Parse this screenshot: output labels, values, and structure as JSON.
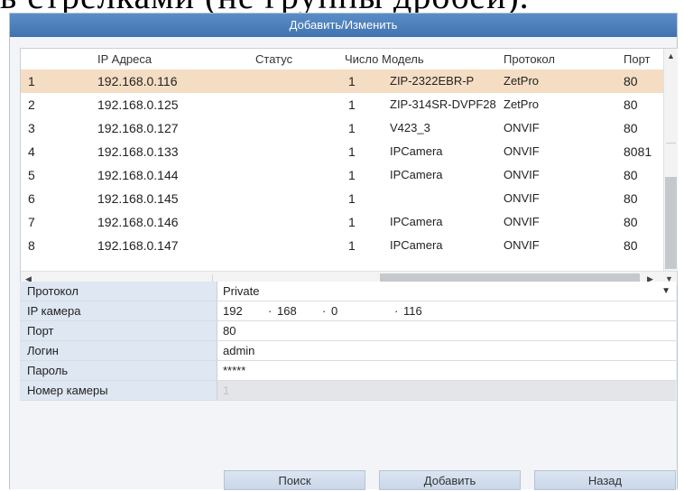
{
  "background_text": "ь стрелками (не группы дробей).",
  "dialog": {
    "title": "Добавить/Изменить"
  },
  "table": {
    "headers": {
      "ip": "IP Адреса",
      "status": "Статус",
      "count": "Число",
      "model": "Модель",
      "protocol": "Протокол",
      "port": "Порт"
    },
    "rows": [
      {
        "num": "1",
        "ip": "192.168.0.116",
        "status": "",
        "count": "1",
        "model": "ZIP-2322EBR-P",
        "protocol": "ZetPro",
        "port": "80",
        "selected": true
      },
      {
        "num": "2",
        "ip": "192.168.0.125",
        "status": "",
        "count": "1",
        "model": "ZIP-314SR-DVPF28",
        "protocol": "ZetPro",
        "port": "80"
      },
      {
        "num": "3",
        "ip": "192.168.0.127",
        "status": "",
        "count": "1",
        "model": "V423_3",
        "protocol": "ONVIF",
        "port": "80"
      },
      {
        "num": "4",
        "ip": "192.168.0.133",
        "status": "",
        "count": "1",
        "model": "IPCamera",
        "protocol": "ONVIF",
        "port": "8081"
      },
      {
        "num": "5",
        "ip": "192.168.0.144",
        "status": "",
        "count": "1",
        "model": "IPCamera",
        "protocol": "ONVIF",
        "port": "80"
      },
      {
        "num": "6",
        "ip": "192.168.0.145",
        "status": "",
        "count": "1",
        "model": "",
        "protocol": "ONVIF",
        "port": "80"
      },
      {
        "num": "7",
        "ip": "192.168.0.146",
        "status": "",
        "count": "1",
        "model": "IPCamera",
        "protocol": "ONVIF",
        "port": "80"
      },
      {
        "num": "8",
        "ip": "192.168.0.147",
        "status": "",
        "count": "1",
        "model": "IPCamera",
        "protocol": "ONVIF",
        "port": "80"
      }
    ]
  },
  "form": {
    "protocol_label": "Протокол",
    "protocol_value": "Private",
    "ip_label": "IP камера",
    "ip_octets": [
      "192",
      "168",
      "0",
      "116"
    ],
    "port_label": "Порт",
    "port_value": "80",
    "login_label": "Логин",
    "login_value": "admin",
    "password_label": "Пароль",
    "password_value": "*****",
    "camera_number_label": "Номер камеры",
    "camera_number_value": "1"
  },
  "buttons": {
    "search": "Поиск",
    "add": "Добавить",
    "back": "Назад"
  },
  "colors": {
    "title_bar": "#4a80bd",
    "selected_row": "#f5ddc4",
    "label_bg": "#dee7f2",
    "button_bg": "#d3deed"
  }
}
